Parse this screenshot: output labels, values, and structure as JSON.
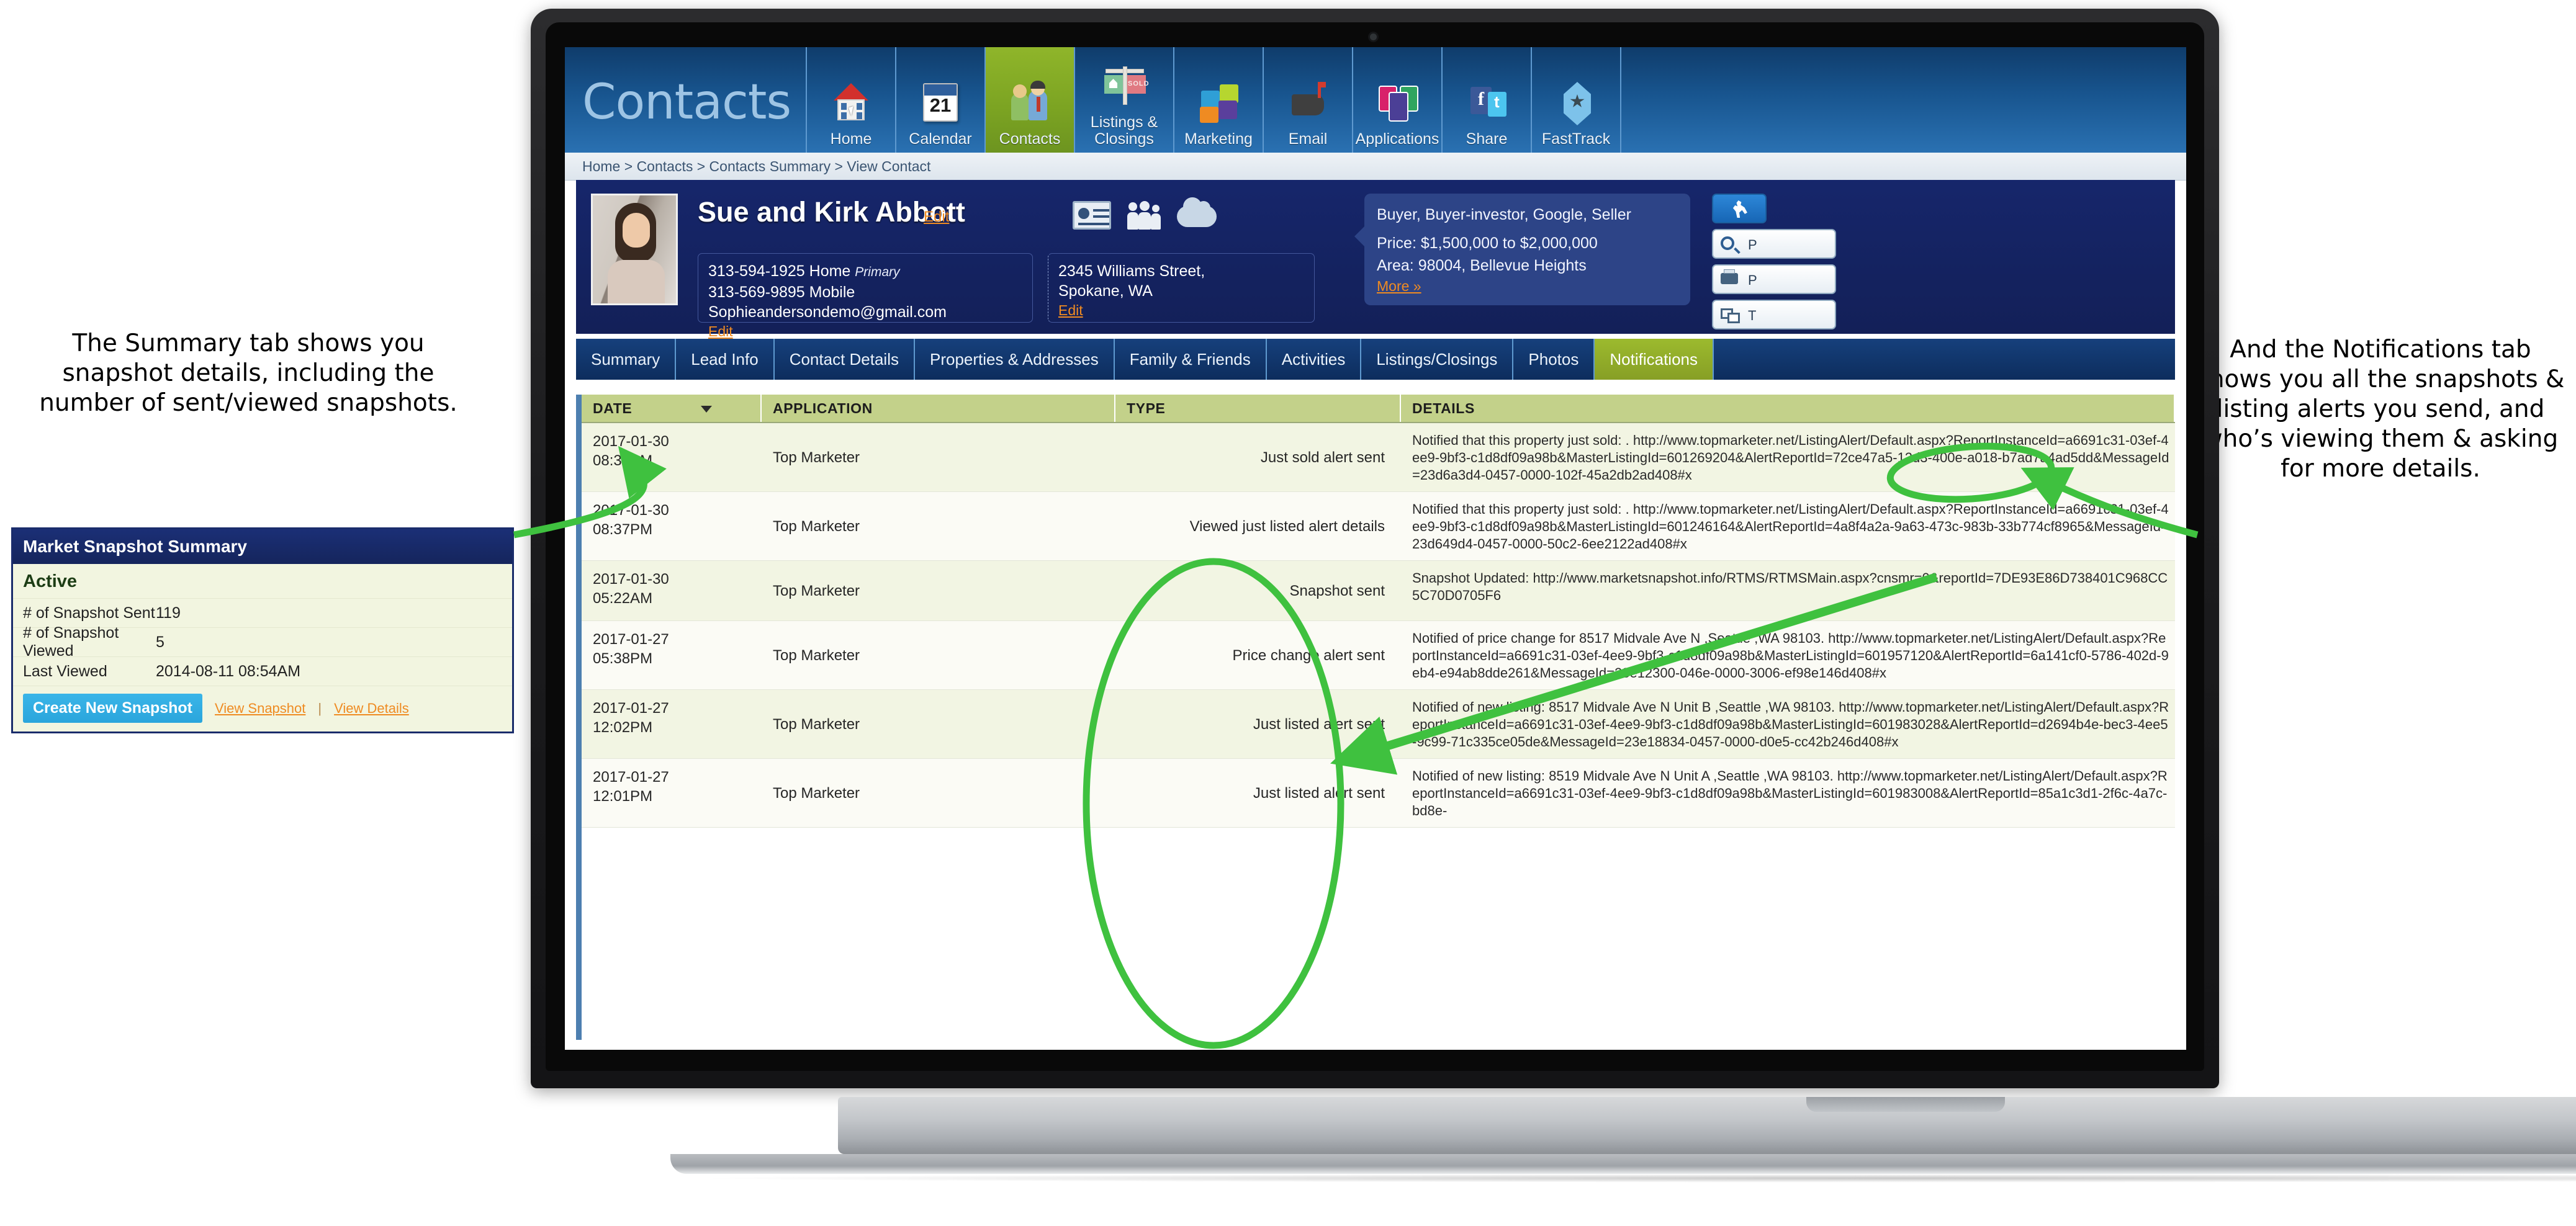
{
  "app": {
    "title": "Contacts",
    "nav": [
      {
        "label": "Home",
        "icon": "house-icon",
        "active": false
      },
      {
        "label": "Calendar",
        "icon": "calendar-icon",
        "active": false,
        "day": "21"
      },
      {
        "label": "Contacts",
        "icon": "people-icon",
        "active": true
      },
      {
        "label": "Listings & Closings",
        "icon": "yard-sign-icon",
        "active": false
      },
      {
        "label": "Marketing",
        "icon": "puzzle-icon",
        "active": false
      },
      {
        "label": "Email",
        "icon": "mailbox-icon",
        "active": false
      },
      {
        "label": "Applications",
        "icon": "app-tiles-icon",
        "active": false
      },
      {
        "label": "Share",
        "icon": "social-icon",
        "active": false
      },
      {
        "label": "FastTrack",
        "icon": "gem-star-icon",
        "active": false
      }
    ],
    "breadcrumb": "Home  >  Contacts  >  Contacts Summary  >  View Contact"
  },
  "contact": {
    "name": "Sue and Kirk Abbott",
    "edit_label": "Edit",
    "phones": [
      "313-594-1925 Home",
      "313-569-9895 Mobile"
    ],
    "primary_tag": "Primary",
    "email": "Sophieandersondemo@gmail.com",
    "phone_edit_label": "Edit",
    "address_line1": "2345 Williams Street,",
    "address_line2": "Spokane, WA",
    "address_edit_label": "Edit",
    "tags": "Buyer, Buyer-investor, Google, Seller",
    "price": "Price: $1,500,000 to $2,000,000",
    "area": "Area: 98004, Bellevue Heights",
    "more_label": "More »",
    "side_buttons": [
      {
        "label": "",
        "icon": "runner-icon"
      },
      {
        "label": "P",
        "icon": "search-icon"
      },
      {
        "label": "P",
        "icon": "print-icon"
      },
      {
        "label": "T",
        "icon": "cards-icon"
      }
    ]
  },
  "tabs": [
    {
      "label": "Summary",
      "active": false
    },
    {
      "label": "Lead Info",
      "active": false
    },
    {
      "label": "Contact Details",
      "active": false
    },
    {
      "label": "Properties & Addresses",
      "active": false
    },
    {
      "label": "Family & Friends",
      "active": false
    },
    {
      "label": "Activities",
      "active": false
    },
    {
      "label": "Listings/Closings",
      "active": false
    },
    {
      "label": "Photos",
      "active": false
    },
    {
      "label": "Notifications",
      "active": true
    }
  ],
  "table": {
    "columns": [
      "DATE",
      "APPLICATION",
      "TYPE",
      "DETAILS"
    ],
    "sort_column": "DATE",
    "sort_direction": "desc",
    "rows": [
      {
        "date": "2017-01-30",
        "time": "08:37PM",
        "application": "Top Marketer",
        "type": "Just sold alert sent",
        "details": "Notified that this property just sold: .  http://www.topmarketer.net/ListingAlert/Default.aspx?ReportInstanceId=a6691c31-03ef-4ee9-9bf3-c1d8df09a98b&MasterListingId=601269204&AlertReportId=72ce47a5-12d3-400e-a018-b7ad7a4ad5dd&MessageId=23d6a3d4-0457-0000-102f-45a2db2ad408#x"
      },
      {
        "date": "2017-01-30",
        "time": "08:37PM",
        "application": "Top Marketer",
        "type": "Viewed just listed alert details",
        "details": "Notified that this property just sold: . http://www.topmarketer.net/ListingAlert/Default.aspx?ReportInstanceId=a6691c31-03ef-4ee9-9bf3-c1d8df09a98b&MasterListingId=601246164&AlertReportId=4a8f4a2a-9a63-473c-983b-33b774cf8965&MessageId=23d649d4-0457-0000-50c2-6ee2122ad408#x"
      },
      {
        "date": "2017-01-30",
        "time": "05:22AM",
        "application": "Top Marketer",
        "type": "Snapshot sent",
        "details": "Snapshot Updated: http://www.marketsnapshot.info/RTMS/RTMSMain.aspx?cnsmr=0&reportId=7DE93E86D738401C968CC5C70D0705F6"
      },
      {
        "date": "2017-01-27",
        "time": "05:38PM",
        "application": "Top Marketer",
        "type": "Price change alert sent",
        "details": "Notified of price change for 8517 Midvale Ave N ,Seattle ,WA 98103. http://www.topmarketer.net/ListingAlert/Default.aspx?ReportInstanceId=a6691c31-03ef-4ee9-9bf3-c1d8df09a98b&MasterListingId=601957120&AlertReportId=6a141cf0-5786-402d-9eb4-e94ab8dde261&MessageId=23e12300-046e-0000-3006-ef98e146d408#x"
      },
      {
        "date": "2017-01-27",
        "time": "12:02PM",
        "application": "Top Marketer",
        "type": "Just listed alert sent",
        "details": "Notified of new listing: 8517 Midvale Ave N Unit B ,Seattle ,WA 98103. http://www.topmarketer.net/ListingAlert/Default.aspx?ReportInstanceId=a6691c31-03ef-4ee9-9bf3-c1d8df09a98b&MasterListingId=601983028&AlertReportId=d2694b4e-bec3-4ee5-9c99-71c335ce05de&MessageId=23e18834-0457-0000-d0e5-cc42b246d408#x"
      },
      {
        "date": "2017-01-27",
        "time": "12:01PM",
        "application": "Top Marketer",
        "type": "Just listed alert sent",
        "details": "Notified of new listing: 8519 Midvale Ave N Unit A ,Seattle ,WA 98103. http://www.topmarketer.net/ListingAlert/Default.aspx?ReportInstanceId=a6691c31-03ef-4ee9-9bf3-c1d8df09a98b&MasterListingId=601983008&AlertReportId=85a1c3d1-2f6c-4a7c-bd8e-"
      }
    ]
  },
  "snapshot_panel": {
    "title": "Market Snapshot Summary",
    "status": "Active",
    "rows": [
      {
        "label": "# of Snapshot Sent",
        "value": "119"
      },
      {
        "label": "# of Snapshot Viewed",
        "value": "5"
      },
      {
        "label": "Last Viewed",
        "value": "2014-08-11 08:54AM"
      }
    ],
    "create_button": "Create New Snapshot",
    "view_snapshot_link": "View Snapshot",
    "separator": "|",
    "view_details_link": "View Details"
  },
  "annotations": {
    "left": "The Summary tab shows you snapshot details, including the number of sent/viewed snapshots.",
    "right": "And the Notifications tab shows you all the snapshots & listing alerts you send, and who’s viewing them & asking for more details."
  },
  "colors": {
    "brand_blue": "#16266b",
    "nav_blue": "#18558f",
    "active_green": "#8fb52a",
    "header_green": "#c3d18a",
    "accent_orange": "#ef8b22",
    "annotation_green": "#3fc13f"
  }
}
